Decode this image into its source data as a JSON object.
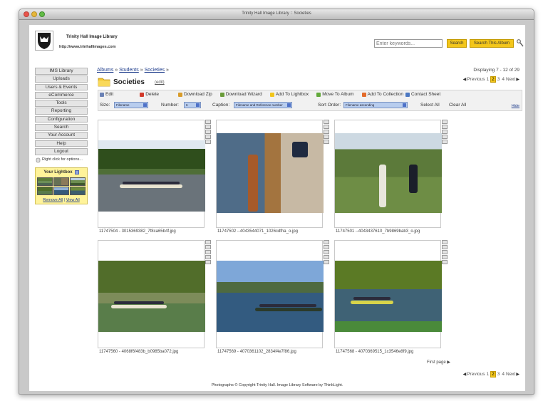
{
  "window": {
    "title": "Trinity Hall Image Library :: Societies"
  },
  "site": {
    "name": "Trinity Hall Image Library",
    "url": "http://www.trinhallimages.com"
  },
  "search": {
    "placeholder": "Enter keywords...",
    "search_label": "Search",
    "search_album_label": "Search This Album"
  },
  "sidebar": {
    "items": [
      {
        "label": "IMS Library"
      },
      {
        "label": "Uploads"
      },
      {
        "label": "Users & Events"
      },
      {
        "label": "eCommerce"
      },
      {
        "label": "Tools"
      },
      {
        "label": "Reporting"
      },
      {
        "label": "Configuration"
      },
      {
        "label": "Search"
      },
      {
        "label": "Your Account"
      },
      {
        "label": "Help"
      },
      {
        "label": "Logout"
      }
    ],
    "hint": "Right click for options...",
    "lightbox": {
      "title": "Your Lightbox",
      "remove_all": "Remove All",
      "view_all": "View All"
    }
  },
  "breadcrumb": {
    "items": [
      "Albums",
      "Students",
      "Societies"
    ],
    "separator": "»",
    "trail_end": "»"
  },
  "page": {
    "title": "Societies",
    "edit_label": "(edit)"
  },
  "paging": {
    "displaying": "Displaying 7 - 12 of 29",
    "previous": "Previous",
    "next": "Next",
    "pages": [
      "1",
      "2",
      "3",
      "4"
    ],
    "current": "2",
    "first_page": "First page"
  },
  "toolbar": {
    "actions": [
      {
        "label": "Edit",
        "icon": "edit-icon"
      },
      {
        "label": "Delete",
        "icon": "delete-icon"
      },
      {
        "label": "Download Zip",
        "icon": "download-zip-icon"
      },
      {
        "label": "Download Wizard",
        "icon": "download-wizard-icon"
      },
      {
        "label": "Add To Lightbox",
        "icon": "lightbox-icon"
      },
      {
        "label": "Move To Album",
        "icon": "move-album-icon"
      },
      {
        "label": "Add To Collection",
        "icon": "collection-icon"
      },
      {
        "label": "Contact Sheet",
        "icon": "contact-sheet-icon"
      }
    ],
    "size_label": "Size:",
    "size_value": "Filename",
    "number_label": "Number:",
    "number_value": "6",
    "caption_label": "Caption:",
    "caption_value": "Filename and Reference number",
    "sort_label": "Sort Order:",
    "sort_value": "Filename ascending",
    "select_all": "Select All",
    "clear_all": "Clear All",
    "hide": "Hide"
  },
  "images": [
    {
      "caption": "11747504 - 3015369382_7f8ca65b4f.jpg"
    },
    {
      "caption": "11747502 --4043544071_1026cdfha_o.jpg"
    },
    {
      "caption": "11747501 --4043437610_7b9869bab3_o.jpg"
    },
    {
      "caption": "11747560 - 4068f6f483b_b0985ba072.jpg"
    },
    {
      "caption": "11747569 - 4070361102_2834f4e7f86.jpg"
    },
    {
      "caption": "11747568 - 4070369515_1c3546e8f9.jpg"
    }
  ],
  "footer": {
    "text": "Photographs © Copyright Trinity Hall. Image Library Software by ThinkLight."
  },
  "colors": {
    "accent": "#f3c61a",
    "lightbox_bg": "#fff39a",
    "link": "#1f3d8c"
  }
}
